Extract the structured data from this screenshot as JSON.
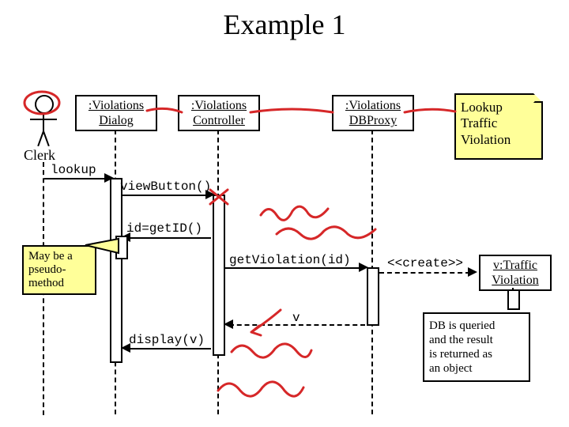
{
  "title": "Example 1",
  "actor": {
    "label": "Clerk"
  },
  "lifelines": {
    "dialog": ":Violations\nDialog",
    "controller": ":Violations\nController",
    "dbproxy": ":Violations\nDBProxy",
    "trafficViolation": "v:Traffic\nViolation"
  },
  "messages": {
    "lookup": "lookup",
    "viewButton": "viewButton()",
    "getID": "id=getID()",
    "getViolation": "getViolation(id)",
    "create": "<<create>>",
    "returnV": "v",
    "display": "display(v)"
  },
  "notes": {
    "lookupNote": "Lookup\nTraffic\nViolation",
    "pseudo": "May be a\npseudo-\nmethod",
    "dbNote": "DB is queried\nand the result\nis returned as\nan object"
  }
}
